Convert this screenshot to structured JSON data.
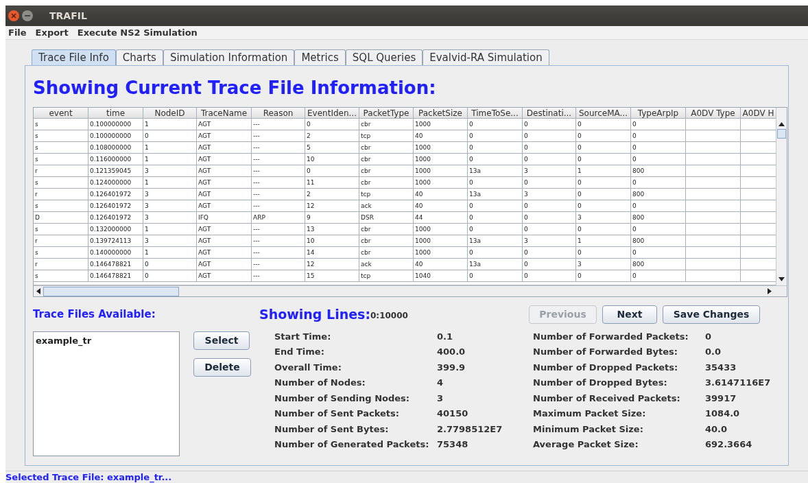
{
  "window": {
    "title": "TRAFIL"
  },
  "menu": [
    "File",
    "Export",
    "Execute NS2 Simulation"
  ],
  "tabs": [
    {
      "label": "Trace File Info",
      "selected": true
    },
    {
      "label": "Charts",
      "selected": false
    },
    {
      "label": "Simulation Information",
      "selected": false
    },
    {
      "label": "Metrics",
      "selected": false
    },
    {
      "label": "SQL Queries",
      "selected": false
    },
    {
      "label": "Evalvid-RA Simulation",
      "selected": false
    }
  ],
  "heading": "Showing Current Trace File Information:",
  "table": {
    "columns": [
      "event",
      "time",
      "NodeID",
      "TraceName",
      "Reason",
      "EventIden...",
      "PacketType",
      "PacketSize",
      "TimeToSe...",
      "Destinati...",
      "SourceMA...",
      "TypeArpIp",
      "A0DV Type",
      "A0DV H"
    ],
    "rows": [
      [
        "s",
        "0.100000000",
        "1",
        "AGT",
        "---",
        "0",
        "cbr",
        "1000",
        "0",
        "0",
        "0",
        "0"
      ],
      [
        "s",
        "0.100000000",
        "0",
        "AGT",
        "---",
        "2",
        "tcp",
        "40",
        "0",
        "0",
        "0",
        "0"
      ],
      [
        "s",
        "0.108000000",
        "1",
        "AGT",
        "---",
        "5",
        "cbr",
        "1000",
        "0",
        "0",
        "0",
        "0"
      ],
      [
        "s",
        "0.116000000",
        "1",
        "AGT",
        "---",
        "10",
        "cbr",
        "1000",
        "0",
        "0",
        "0",
        "0"
      ],
      [
        "r",
        "0.121359045",
        "3",
        "AGT",
        "---",
        "0",
        "cbr",
        "1000",
        "13a",
        "3",
        "1",
        "800"
      ],
      [
        "s",
        "0.124000000",
        "1",
        "AGT",
        "---",
        "11",
        "cbr",
        "1000",
        "0",
        "0",
        "0",
        "0"
      ],
      [
        "r",
        "0.126401972",
        "3",
        "AGT",
        "---",
        "2",
        "tcp",
        "40",
        "13a",
        "3",
        "0",
        "800"
      ],
      [
        "s",
        "0.126401972",
        "3",
        "AGT",
        "---",
        "12",
        "ack",
        "40",
        "0",
        "0",
        "0",
        "0"
      ],
      [
        "D",
        "0.126401972",
        "3",
        "IFQ",
        "ARP",
        "9",
        "DSR",
        "44",
        "0",
        "0",
        "3",
        "800"
      ],
      [
        "s",
        "0.132000000",
        "1",
        "AGT",
        "---",
        "13",
        "cbr",
        "1000",
        "0",
        "0",
        "0",
        "0"
      ],
      [
        "r",
        "0.139724113",
        "3",
        "AGT",
        "---",
        "10",
        "cbr",
        "1000",
        "13a",
        "3",
        "1",
        "800"
      ],
      [
        "s",
        "0.140000000",
        "1",
        "AGT",
        "---",
        "14",
        "cbr",
        "1000",
        "0",
        "0",
        "0",
        "0"
      ],
      [
        "r",
        "0.146478821",
        "0",
        "AGT",
        "---",
        "12",
        "ack",
        "40",
        "13a",
        "0",
        "3",
        "800"
      ],
      [
        "s",
        "0.146478821",
        "0",
        "AGT",
        "---",
        "15",
        "tcp",
        "1040",
        "0",
        "0",
        "0",
        "0"
      ]
    ]
  },
  "trace_files": {
    "title": "Trace Files Available:",
    "items": [
      {
        "name": "example_tr",
        "selected": false
      }
    ]
  },
  "showing_lines": {
    "label": "Showing Lines:",
    "value": "0:10000"
  },
  "buttons": {
    "previous": {
      "label": "Previous",
      "disabled": true
    },
    "next": {
      "label": "Next",
      "disabled": false
    },
    "save": {
      "label": "Save Changes",
      "disabled": false
    },
    "select": {
      "label": "Select",
      "disabled": false
    },
    "delete": {
      "label": "Delete",
      "disabled": false
    }
  },
  "stats_left": [
    {
      "label": "Start Time:",
      "value": "0.1"
    },
    {
      "label": "End Time:",
      "value": "400.0"
    },
    {
      "label": "Overall Time:",
      "value": "399.9"
    },
    {
      "label": "Number of Nodes:",
      "value": "4"
    },
    {
      "label": "Number of Sending Nodes:",
      "value": "3"
    },
    {
      "label": "Number of Sent Packets:",
      "value": "40150"
    },
    {
      "label": "Number of Sent Bytes:",
      "value": "2.7798512E7"
    },
    {
      "label": "Number of Generated Packets:",
      "value": "75348"
    }
  ],
  "stats_right": [
    {
      "label": "Number of Forwarded Packets:",
      "value": "0"
    },
    {
      "label": "Number of Forwarded Bytes:",
      "value": "0.0"
    },
    {
      "label": "Number of Dropped Packets:",
      "value": "35433"
    },
    {
      "label": "Number of Dropped Bytes:",
      "value": "3.6147116E7"
    },
    {
      "label": "Number of Received Packets:",
      "value": "39917"
    },
    {
      "label": "Maximum Packet Size:",
      "value": "1084.0"
    },
    {
      "label": "Minimum Packet Size:",
      "value": "40.0"
    },
    {
      "label": "Average Packet Size:",
      "value": "692.3664"
    }
  ],
  "status_bar": "Selected Trace File: example_tr..."
}
